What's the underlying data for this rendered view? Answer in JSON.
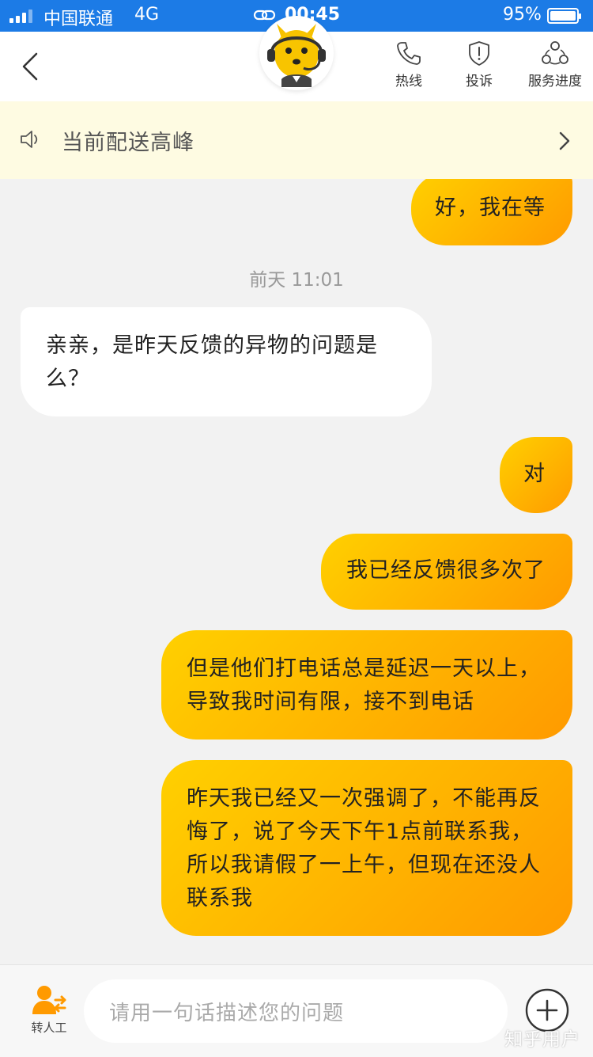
{
  "status_bar": {
    "carrier": "中国联通",
    "network": "4G",
    "time": "00:45",
    "battery": "95%",
    "battery_level": 0.95
  },
  "header": {
    "actions": [
      {
        "label": "热线",
        "icon": "phone-icon"
      },
      {
        "label": "投诉",
        "icon": "shield-alert-icon"
      },
      {
        "label": "服务进度",
        "icon": "progress-circles-icon"
      }
    ],
    "avatar": "kangaroo-agent-avatar"
  },
  "notice": {
    "text": "当前配送高峰"
  },
  "messages": [
    {
      "from": "me",
      "text": "好，我在等"
    },
    {
      "type": "time",
      "text": "前天 11:01"
    },
    {
      "from": "other",
      "text": "亲亲，是昨天反馈的异物的问题是么？"
    },
    {
      "from": "me",
      "text": "对"
    },
    {
      "from": "me",
      "text": "我已经反馈很多次了"
    },
    {
      "from": "me",
      "text": "但是他们打电话总是延迟一天以上，导致我时间有限，接不到电话"
    },
    {
      "from": "me",
      "text": "昨天我已经又一次强调了，不能再反悔了，说了今天下午1点前联系我，所以我请假了一上午，但现在还没人联系我"
    }
  ],
  "input_bar": {
    "transfer_label": "转人工",
    "placeholder": "请用一句话描述您的问题"
  },
  "watermark": "知乎用户",
  "colors": {
    "status_bar": "#1c7be6",
    "my_bubble_start": "#ffd000",
    "my_bubble_end": "#ff9a00",
    "notice_bg": "#fefbe2",
    "accent_orange": "#ff9a00"
  }
}
